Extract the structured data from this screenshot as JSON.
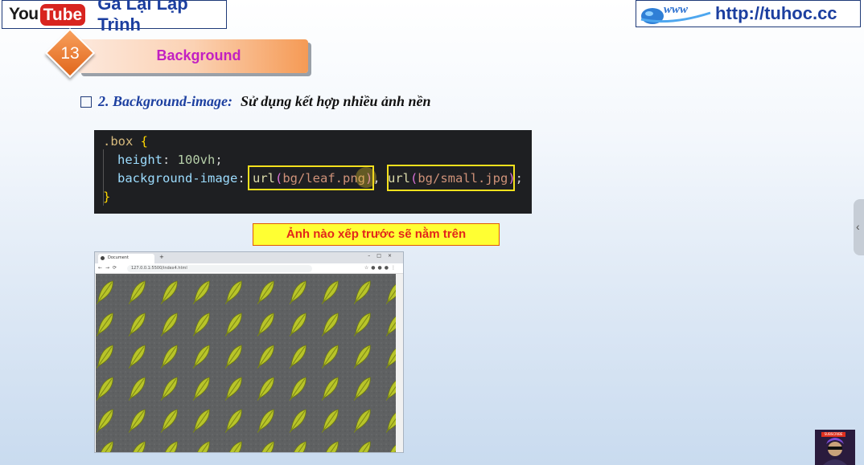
{
  "header": {
    "youtube_you": "You",
    "youtube_tube": "Tube",
    "channel_name": "Gà Lại Lập Trình",
    "website": "http://tuhoc.cc",
    "www_logo_text": "www"
  },
  "slide": {
    "number": "13",
    "title": "Background",
    "heading_blue": "2. Background-image:",
    "heading_black": "Sử dụng kết hợp nhiều ảnh nền"
  },
  "code": {
    "line1_selector": ".box",
    "line1_brace": "{",
    "line2_prop": "height",
    "line2_value": "100vh",
    "line3_prop": "background-image",
    "url1_fn": "url",
    "url1_arg": "bg/leaf.png",
    "url2_fn": "url",
    "url2_arg": "bg/small.jpg",
    "line4_brace": "}"
  },
  "note": "Ảnh nào xếp trước sẽ nằm trên",
  "browser": {
    "tab_title": "Document",
    "address": "127.0.0.1:5500/index4.html"
  },
  "avatar": {
    "badge": "SUBSCRIBE"
  },
  "colors": {
    "channel_text": "#1c3fa0",
    "banner_title": "#c220c2",
    "note_background": "#ffff33",
    "note_text": "#e2261a",
    "code_background": "#1e1f22",
    "highlight_box": "#f5e11d",
    "leaf": "#b8c42a"
  }
}
